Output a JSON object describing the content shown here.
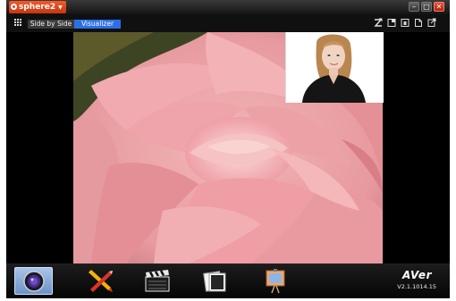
{
  "titlebar": {
    "app_name": "sphere2",
    "controls": {
      "minimize": "–",
      "maximize": "□",
      "close": "✕"
    }
  },
  "toolbar": {
    "tabs": [
      {
        "label": "Side by Side",
        "active": false
      },
      {
        "label": "Visualizer",
        "active": true
      }
    ],
    "right_icons": [
      "z-icon",
      "layout-icon",
      "panel-icon",
      "document-icon",
      "export-icon"
    ]
  },
  "stage": {
    "main_image": "pink-rose-photo",
    "pip_image": "portrait-photo"
  },
  "dock": {
    "buttons": [
      "camera-lens",
      "annotation-tools",
      "record-clapperboard",
      "gallery-photos",
      "presentation-board"
    ],
    "brand": "AVer",
    "version": "V2.1.1014.15"
  },
  "colors": {
    "accent": "#2b6fe8",
    "logo": "#e8461d",
    "close": "#d0381d"
  }
}
